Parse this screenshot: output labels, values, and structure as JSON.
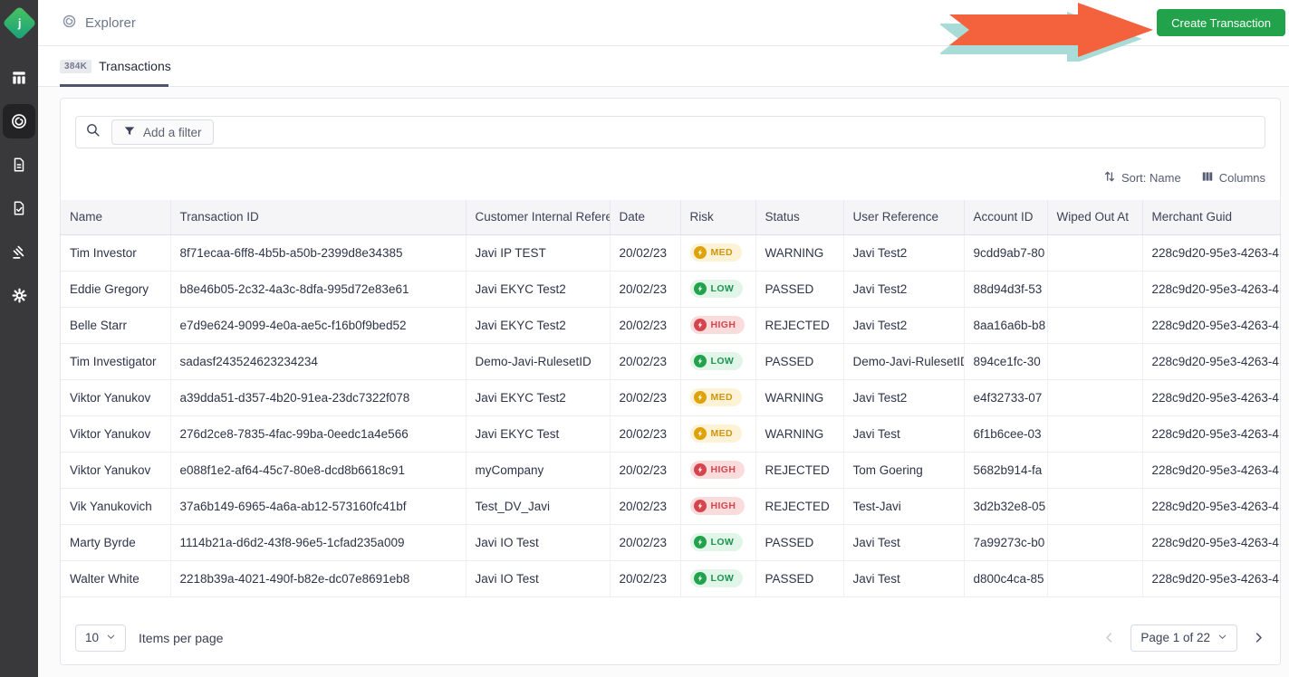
{
  "sidebar": {
    "logo_letter": "j",
    "items": [
      {
        "id": "dashboard",
        "icon": "table-columns-icon",
        "active": false
      },
      {
        "id": "explorer",
        "icon": "explorer-spiral-icon",
        "active": true
      },
      {
        "id": "documents",
        "icon": "document-icon",
        "active": false
      },
      {
        "id": "reports",
        "icon": "document-check-icon",
        "active": false
      },
      {
        "id": "rules",
        "icon": "gavel-icon",
        "active": false
      },
      {
        "id": "settings",
        "icon": "gear-icon",
        "active": false
      }
    ]
  },
  "header": {
    "title": "Explorer",
    "create_button_label": "Create Transaction"
  },
  "tabs": {
    "count_badge": "384K",
    "label": "Transactions"
  },
  "filter": {
    "add_filter_label": "Add a filter"
  },
  "controls": {
    "sort_label": "Sort: Name",
    "columns_label": "Columns"
  },
  "table": {
    "columns": [
      "Name",
      "Transaction ID",
      "Customer Internal Reference",
      "Date",
      "Risk",
      "Status",
      "User Reference",
      "Account ID",
      "Wiped Out At",
      "Merchant Guid"
    ],
    "rows": [
      {
        "name": "Tim Investor",
        "transaction_id": "8f71ecaa-6ff8-4b5b-a50b-2399d8e34385",
        "customer_internal_ref": "Javi IP TEST",
        "date": "20/02/23",
        "risk": "MED",
        "status": "WARNING",
        "user_reference": "Javi Test2",
        "account_id": "9cdd9ab7-80",
        "wiped_out_at": "",
        "merchant_guid": "228c9d20-95e3-4263-4"
      },
      {
        "name": "Eddie Gregory",
        "transaction_id": "b8e46b05-2c32-4a3c-8dfa-995d72e83e61",
        "customer_internal_ref": "Javi EKYC Test2",
        "date": "20/02/23",
        "risk": "LOW",
        "status": "PASSED",
        "user_reference": "Javi Test2",
        "account_id": "88d94d3f-53",
        "wiped_out_at": "",
        "merchant_guid": "228c9d20-95e3-4263-4"
      },
      {
        "name": "Belle Starr",
        "transaction_id": "e7d9e624-9099-4e0a-ae5c-f16b0f9bed52",
        "customer_internal_ref": "Javi EKYC Test2",
        "date": "20/02/23",
        "risk": "HIGH",
        "status": "REJECTED",
        "user_reference": "Javi Test2",
        "account_id": "8aa16a6b-b8",
        "wiped_out_at": "",
        "merchant_guid": "228c9d20-95e3-4263-4"
      },
      {
        "name": "Tim Investigator",
        "transaction_id": "sadasf243524623234234",
        "customer_internal_ref": "Demo-Javi-RulesetID",
        "date": "20/02/23",
        "risk": "LOW",
        "status": "PASSED",
        "user_reference": "Demo-Javi-RulesetID",
        "account_id": "894ce1fc-30",
        "wiped_out_at": "",
        "merchant_guid": "228c9d20-95e3-4263-4"
      },
      {
        "name": "Viktor Yanukov",
        "transaction_id": "a39dda51-d357-4b20-91ea-23dc7322f078",
        "customer_internal_ref": "Javi EKYC Test2",
        "date": "20/02/23",
        "risk": "MED",
        "status": "WARNING",
        "user_reference": "Javi Test2",
        "account_id": "e4f32733-07",
        "wiped_out_at": "",
        "merchant_guid": "228c9d20-95e3-4263-4"
      },
      {
        "name": "Viktor Yanukov",
        "transaction_id": "276d2ce8-7835-4fac-99ba-0eedc1a4e566",
        "customer_internal_ref": "Javi EKYC Test",
        "date": "20/02/23",
        "risk": "MED",
        "status": "WARNING",
        "user_reference": "Javi Test",
        "account_id": "6f1b6cee-03",
        "wiped_out_at": "",
        "merchant_guid": "228c9d20-95e3-4263-4"
      },
      {
        "name": "Viktor Yanukov",
        "transaction_id": "e088f1e2-af64-45c7-80e8-dcd8b6618c91",
        "customer_internal_ref": "myCompany",
        "date": "20/02/23",
        "risk": "HIGH",
        "status": "REJECTED",
        "user_reference": "Tom Goering",
        "account_id": "5682b914-fa",
        "wiped_out_at": "",
        "merchant_guid": "228c9d20-95e3-4263-4"
      },
      {
        "name": "Vik Yanukovich",
        "transaction_id": "37a6b149-6965-4a6a-ab12-573160fc41bf",
        "customer_internal_ref": "Test_DV_Javi",
        "date": "20/02/23",
        "risk": "HIGH",
        "status": "REJECTED",
        "user_reference": "Test-Javi",
        "account_id": "3d2b32e8-05",
        "wiped_out_at": "",
        "merchant_guid": "228c9d20-95e3-4263-4"
      },
      {
        "name": "Marty Byrde",
        "transaction_id": "1114b21a-d6d2-43f8-96e5-1cfad235a009",
        "customer_internal_ref": "Javi IO Test",
        "date": "20/02/23",
        "risk": "LOW",
        "status": "PASSED",
        "user_reference": "Javi Test",
        "account_id": "7a99273c-b0",
        "wiped_out_at": "",
        "merchant_guid": "228c9d20-95e3-4263-4"
      },
      {
        "name": "Walter White",
        "transaction_id": "2218b39a-4021-490f-b82e-dc07e8691eb8",
        "customer_internal_ref": "Javi IO Test",
        "date": "20/02/23",
        "risk": "LOW",
        "status": "PASSED",
        "user_reference": "Javi Test",
        "account_id": "d800c4ca-85",
        "wiped_out_at": "",
        "merchant_guid": "228c9d20-95e3-4263-4"
      }
    ]
  },
  "pagination": {
    "items_per_page_value": "10",
    "items_per_page_label": "Items per page",
    "page_label": "Page 1 of 22"
  },
  "colors": {
    "accent_green": "#21a24b",
    "arrow": "#f4613d",
    "arrow_shadow": "#a9dcd6",
    "sidebar_bg": "#39393b",
    "risk_med_text": "#d0950b",
    "risk_low_text": "#1b9450",
    "risk_high_text": "#d6454e",
    "tab_underline": "#50556b"
  },
  "icons": [
    "table-columns-icon",
    "explorer-spiral-icon",
    "document-icon",
    "document-check-icon",
    "gavel-icon",
    "gear-icon",
    "search-icon",
    "funnel-icon",
    "sort-arrows-icon",
    "columns-icon",
    "chevron-down-icon",
    "chevron-left-icon",
    "chevron-right-icon",
    "lightning-icon",
    "annotation-arrow"
  ]
}
